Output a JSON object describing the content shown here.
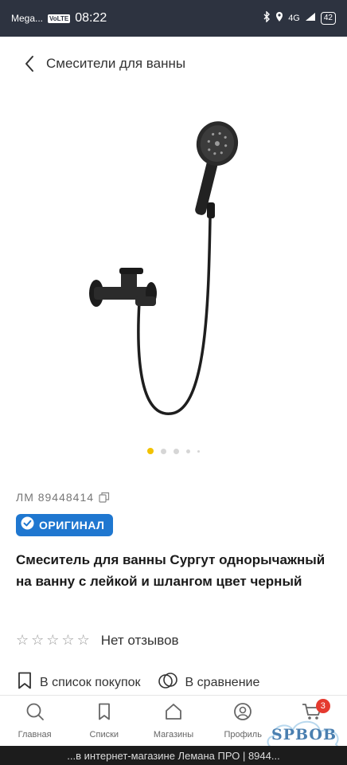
{
  "status_bar": {
    "carrier": "Mega...",
    "vowifi": "VoLTE",
    "time": "08:22",
    "network": "4G",
    "battery": "42"
  },
  "header": {
    "title": "Смесители для ванны",
    "back_icon": "chevron-left-icon"
  },
  "gallery": {
    "image": "shower-mixer-product-photo",
    "image_count": 5,
    "active_index": 0,
    "active_color": "#f2c200"
  },
  "product": {
    "article": "ЛМ 89448414",
    "badge": "ОРИГИНАЛ",
    "badge_color": "#1f77d0",
    "title": "Смеситель для ванны Сургут однорычажный на ванну с лейкой и шлангом цвет черный",
    "rating_stars": 0,
    "reviews": "Нет отзывов"
  },
  "actions": {
    "shopping_list": "В список покупок",
    "compare": "В сравнение"
  },
  "bottom_nav": {
    "items": [
      {
        "label": "Главная",
        "icon": "search-icon"
      },
      {
        "label": "Списки",
        "icon": "bookmark-icon"
      },
      {
        "label": "Магазины",
        "icon": "store-icon"
      },
      {
        "label": "Профиль",
        "icon": "profile-icon"
      },
      {
        "label": "",
        "icon": "cart-icon",
        "badge": "3"
      }
    ]
  },
  "caption": "...в интернет-магазине Лемана ПРО | 8944...",
  "watermark": "SPBOB"
}
